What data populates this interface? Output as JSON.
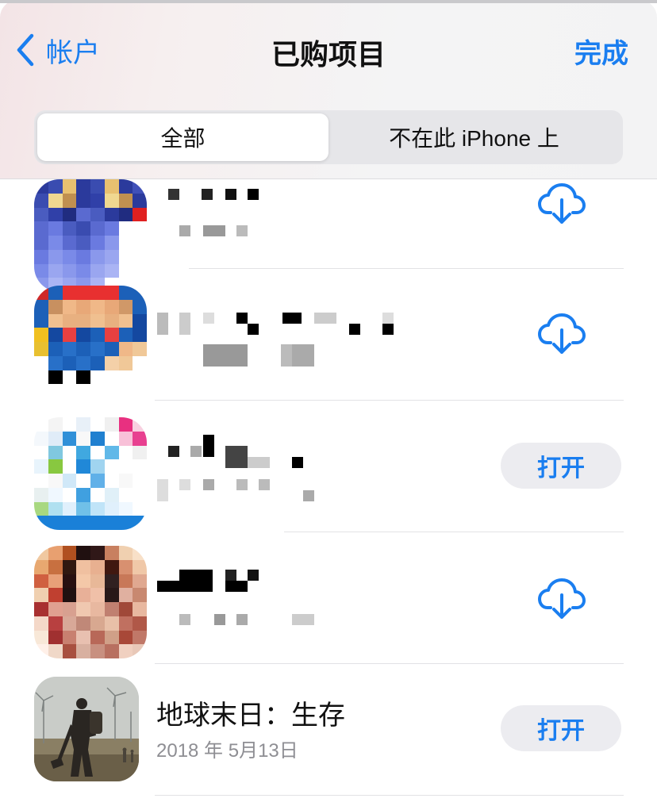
{
  "header": {
    "back_label": "帐户",
    "title": "已购项目",
    "done_label": "完成",
    "segments": [
      "全部",
      "不在此 iPhone 上"
    ],
    "selected_segment": "全部"
  },
  "apps": [
    {
      "name": "",
      "date": "",
      "action": "download",
      "icon": "blurred-app-icon"
    },
    {
      "name": "",
      "date": "",
      "action": "download",
      "icon": "blurred-app-icon"
    },
    {
      "name": "",
      "date": "",
      "action": "open",
      "action_label": "打开",
      "icon": "blurred-app-icon"
    },
    {
      "name": "",
      "date": "",
      "action": "download",
      "icon": "blurred-app-icon"
    },
    {
      "name": "地球末日：生存",
      "date": "2018 年 5月13日",
      "action": "open",
      "action_label": "打开",
      "icon": "survivor-game-icon"
    }
  ],
  "colors": {
    "accent": "#1a7ef0",
    "pill_bg": "#ececf0",
    "secondary_text": "#8e8e93"
  }
}
